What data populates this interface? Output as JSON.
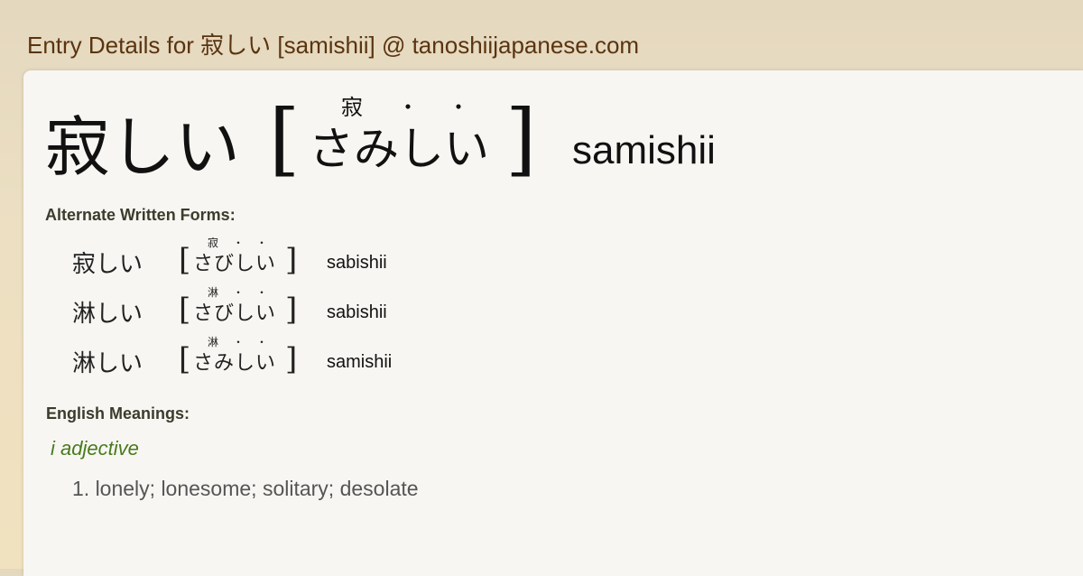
{
  "page": {
    "title": "Entry Details for 寂しい [samishii] @ tanoshiijapanese.com"
  },
  "entry": {
    "word": "寂しい",
    "reading": "さみしい",
    "furigana": "寂",
    "furigana_dots": [
      "・",
      "・"
    ],
    "bracket_open": "[",
    "bracket_close": "]",
    "romaji": "samishii"
  },
  "alternate_forms": {
    "label": "Alternate Written Forms:",
    "items": [
      {
        "word": "寂しい",
        "furigana": "寂",
        "reading": "さびしい",
        "romaji": "sabishii"
      },
      {
        "word": "淋しい",
        "furigana": "淋",
        "reading": "さびしい",
        "romaji": "sabishii"
      },
      {
        "word": "淋しい",
        "furigana": "淋",
        "reading": "さみしい",
        "romaji": "samishii"
      }
    ]
  },
  "english_meanings": {
    "label": "English Meanings:",
    "part_of_speech": "i adjective",
    "items": [
      "1. lonely; lonesome; solitary; desolate"
    ]
  }
}
